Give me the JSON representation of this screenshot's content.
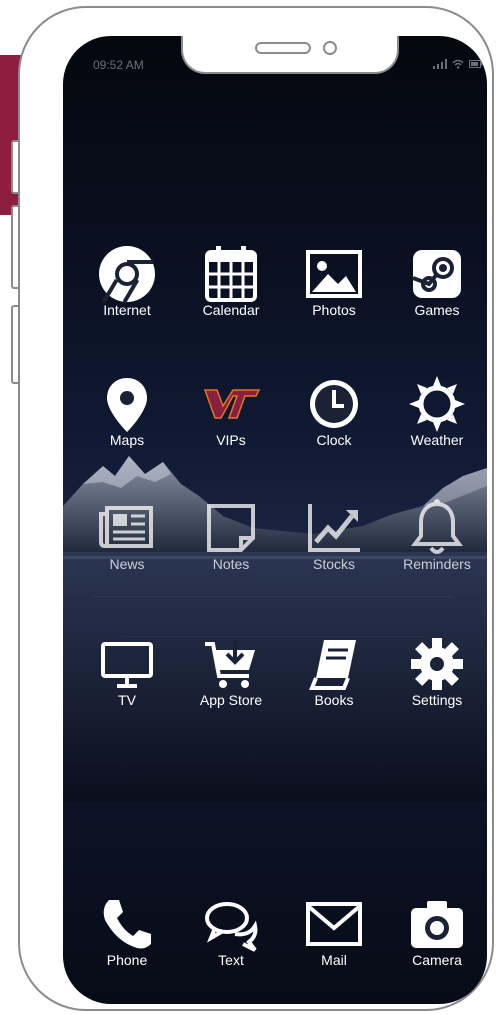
{
  "status_bar": {
    "time": "09:52 AM"
  },
  "apps": [
    {
      "label": "Internet",
      "icon": "chrome-icon"
    },
    {
      "label": "Calendar",
      "icon": "calendar-icon"
    },
    {
      "label": "Photos",
      "icon": "photo-icon"
    },
    {
      "label": "Games",
      "icon": "steam-icon"
    },
    {
      "label": "Maps",
      "icon": "map-pin-icon"
    },
    {
      "label": "VIPs",
      "icon": "vt-logo-icon"
    },
    {
      "label": "Clock",
      "icon": "clock-icon"
    },
    {
      "label": "Weather",
      "icon": "sun-icon"
    },
    {
      "label": "News",
      "icon": "newspaper-icon"
    },
    {
      "label": "Notes",
      "icon": "sticky-note-icon"
    },
    {
      "label": "Stocks",
      "icon": "chart-line-icon"
    },
    {
      "label": "Reminders",
      "icon": "bell-icon"
    },
    {
      "label": "TV",
      "icon": "tv-icon"
    },
    {
      "label": "App Store",
      "icon": "cart-download-icon"
    },
    {
      "label": "Books",
      "icon": "book-icon"
    },
    {
      "label": "Settings",
      "icon": "gear-icon"
    }
  ],
  "dock": [
    {
      "label": "Phone",
      "icon": "phone-icon"
    },
    {
      "label": "Text",
      "icon": "chat-bubbles-icon"
    },
    {
      "label": "Mail",
      "icon": "envelope-icon"
    },
    {
      "label": "Camera",
      "icon": "camera-icon"
    }
  ],
  "colors": {
    "accent": "#8e1d40",
    "vt_maroon": "#861f41",
    "vt_orange": "#e5751f"
  }
}
